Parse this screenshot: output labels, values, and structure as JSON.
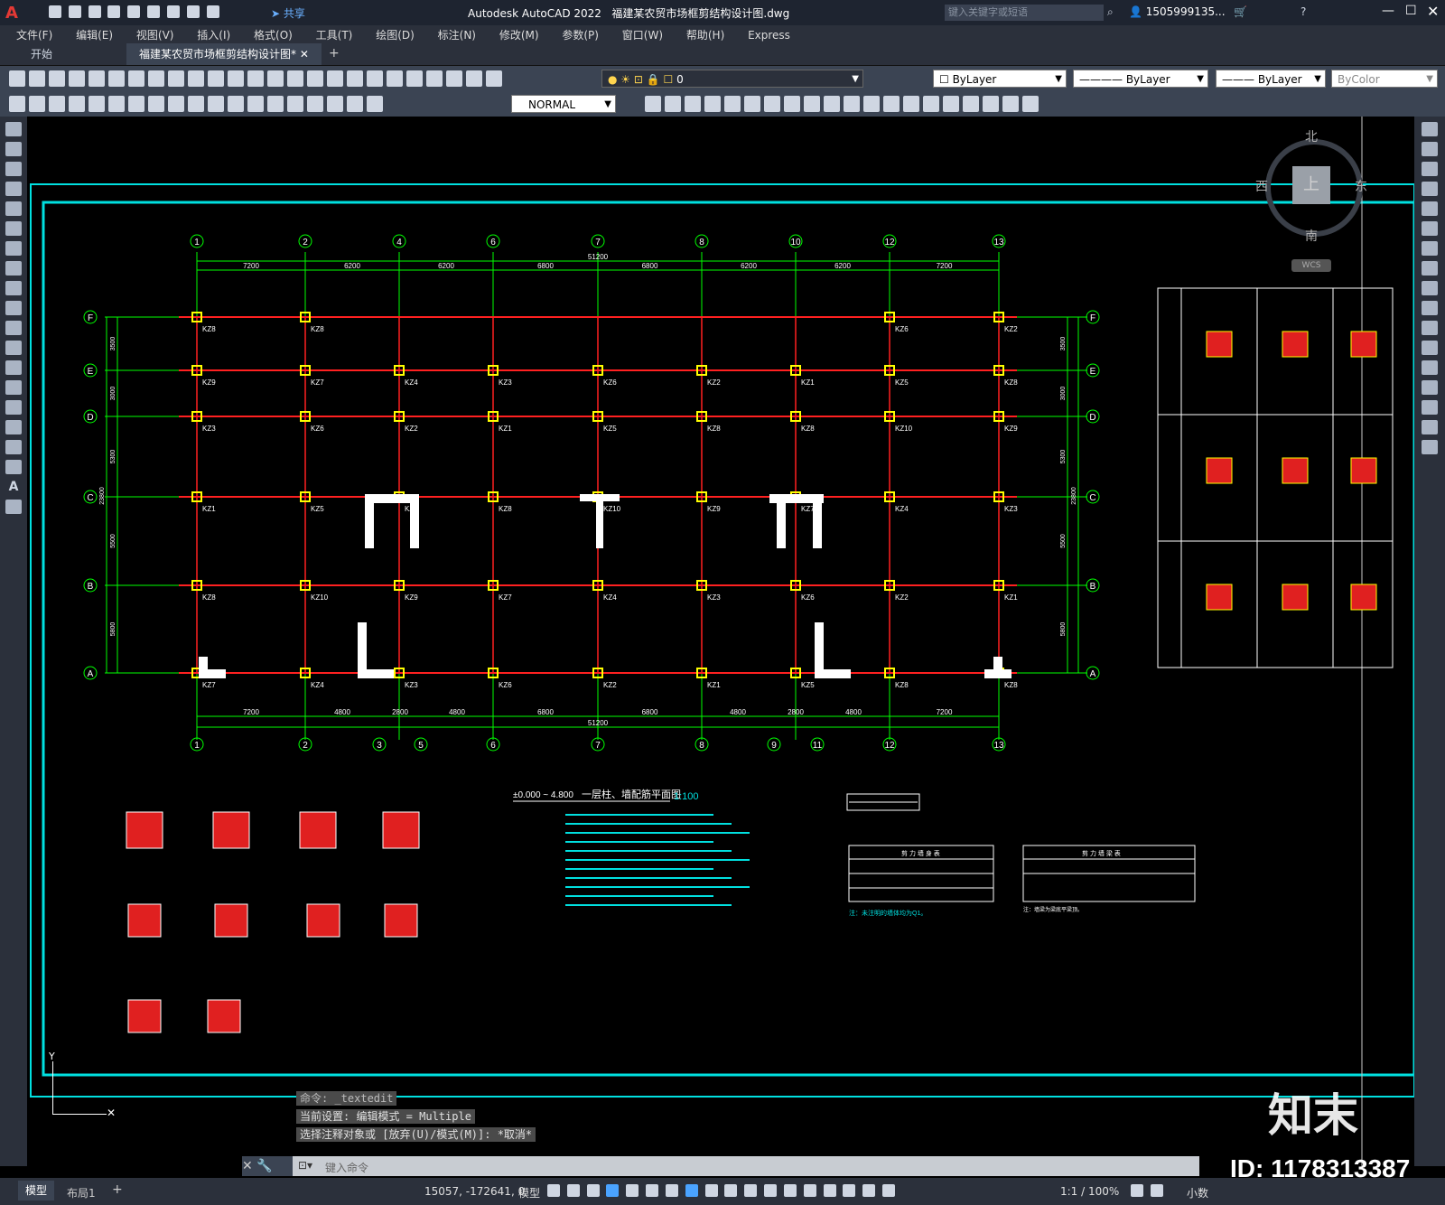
{
  "app": {
    "title": "Autodesk AutoCAD 2022",
    "file_title": "福建某农贸市场框剪结构设计图.dwg",
    "share_label": "共享",
    "search_placeholder": "键入关键字或短语",
    "user": "1505999135..."
  },
  "menu": [
    "文件(F)",
    "编辑(E)",
    "视图(V)",
    "插入(I)",
    "格式(O)",
    "工具(T)",
    "绘图(D)",
    "标注(N)",
    "修改(M)",
    "参数(P)",
    "窗口(W)",
    "帮助(H)",
    "Express"
  ],
  "tabs": {
    "start": "开始",
    "doc": "福建某农贸市场框剪结构设计图*"
  },
  "toolbar": {
    "layer_value": "0",
    "color_value": "ByLayer",
    "linetype_value": "ByLayer",
    "lineweight_value": "ByLayer",
    "plotstyle_value": "ByColor",
    "dimstyle_value": "NORMAL"
  },
  "viewcube": {
    "north": "北",
    "south": "南",
    "east": "东",
    "west": "西",
    "top": "上",
    "wcs": "WCS"
  },
  "drawing": {
    "grid_numbers_top": [
      "1",
      "2",
      "4",
      "6",
      "7",
      "8",
      "10",
      "12",
      "13"
    ],
    "grid_numbers_bottom": [
      "1",
      "2",
      "3",
      "5",
      "6",
      "7",
      "8",
      "9",
      "11",
      "12",
      "13"
    ],
    "grid_letters": [
      "F",
      "E",
      "D",
      "C",
      "B",
      "A"
    ],
    "total_dim": "51200",
    "top_spans": [
      "7200",
      "6200",
      "6200",
      "6800",
      "6800",
      "6200",
      "6200",
      "7200"
    ],
    "bottom_spans": [
      "7200",
      "4800",
      "2800",
      "4800",
      "6800",
      "6800",
      "4800",
      "2800",
      "4800",
      "7200"
    ],
    "row_spans": [
      "3500",
      "3000",
      "5300",
      "5500",
      "5800"
    ],
    "total_row_dim": "23800",
    "title": "一层柱、墙配筋平面图",
    "scale": "1:100",
    "elevation": "±0.000 ~ 4.800",
    "column_tags": [
      "KZ8",
      "KZ8",
      "KZ10",
      "KZ9",
      "KZ7",
      "KZ4",
      "KZ3",
      "KZ6",
      "KZ2",
      "KZ1",
      "KZ5"
    ],
    "wall_table_title": "剪 力 墙 身 表",
    "beam_table_title": "剪 力 墙 梁 表",
    "note_text": "注：未注明的墙体均为Q1。",
    "beam_note": "注：墙梁为梁底平梁顶。"
  },
  "command": {
    "history": [
      "命令: _textedit",
      "当前设置: 编辑模式 = Multiple",
      "选择注释对象或 [放弃(U)/模式(M)]: *取消*"
    ],
    "placeholder": "键入命令"
  },
  "status": {
    "model_tab": "模型",
    "layout_tab": "布局1",
    "coords": "15057, -172641, 0",
    "model_label": "模型",
    "scale": "1:1 / 100%",
    "units": "小数"
  },
  "watermark": {
    "brand": "知末",
    "id": "ID: 1178313387"
  },
  "colors": {
    "grid": "#00ff00",
    "beam": "#ff2020",
    "column": "#ffff00",
    "frame": "#00e0e0",
    "accent": "#d32f2f"
  }
}
